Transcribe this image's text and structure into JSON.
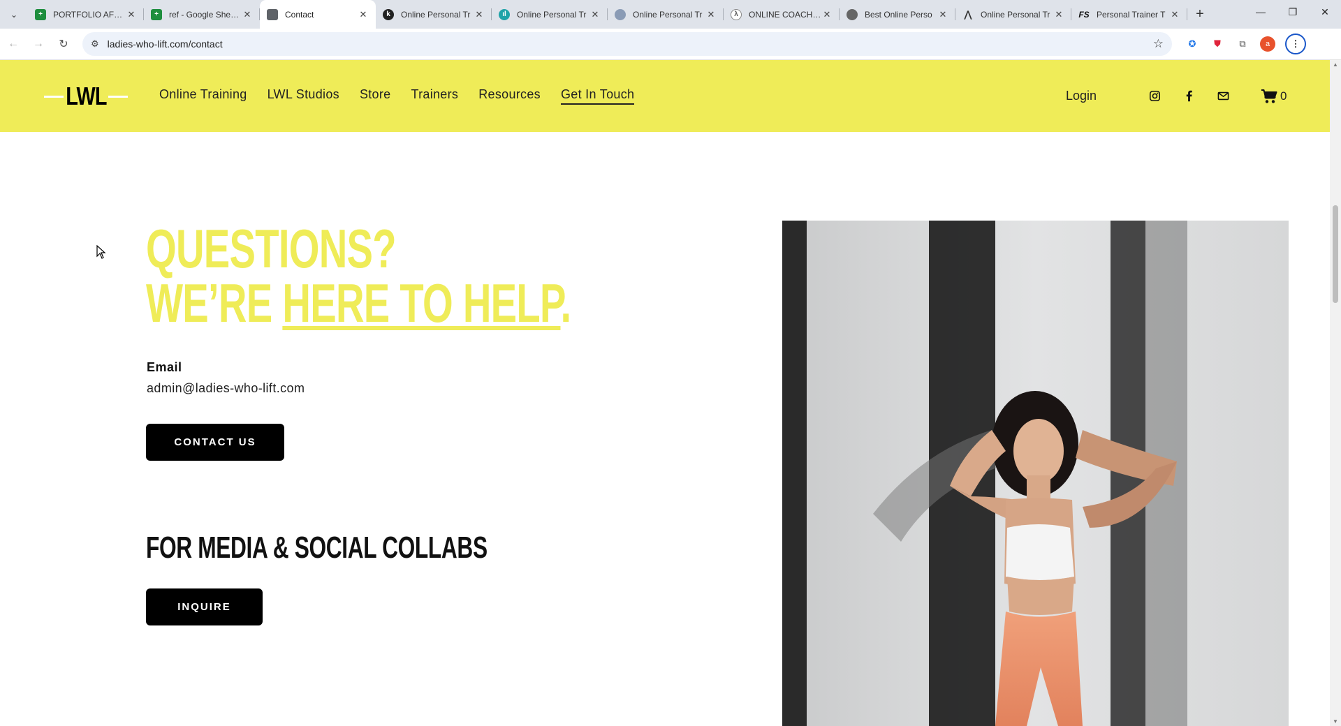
{
  "browser": {
    "tabs": [
      {
        "title": "PORTFOLIO AFTER",
        "favicon": "sheets-icon",
        "active": false
      },
      {
        "title": "ref - Google Sheets",
        "favicon": "sheets-icon",
        "active": false
      },
      {
        "title": "Contact",
        "favicon": "cube-icon",
        "active": true
      },
      {
        "title": "Online Personal Tr",
        "favicon": "k-icon",
        "active": false
      },
      {
        "title": "Online Personal Tr",
        "favicon": "bars-icon",
        "active": false
      },
      {
        "title": "Online Personal Tr",
        "favicon": "globe-icon",
        "active": false
      },
      {
        "title": "ONLINE COACHING",
        "favicon": "runner-icon",
        "active": false
      },
      {
        "title": "Best Online Perso",
        "favicon": "globe-icon",
        "active": false
      },
      {
        "title": "Online Personal Tr",
        "favicon": "tent-icon",
        "active": false
      },
      {
        "title": "Personal Trainer T",
        "favicon": "fs-icon",
        "active": false
      }
    ],
    "url": "ladies-who-lift.com/contact",
    "profile_initial": "a"
  },
  "site": {
    "logo_text": "LWL",
    "nav": [
      "Online Training",
      "LWL Studios",
      "Store",
      "Trainers",
      "Resources",
      "Get In Touch"
    ],
    "current_nav": "Get In Touch",
    "login_label": "Login",
    "cart_count": "0",
    "accent_color": "#efec58"
  },
  "contact": {
    "headline_line1": "QUESTIONS?",
    "headline_line2_prefix": "WE’RE ",
    "headline_line2_underlined": "HERE TO HELP",
    "headline_line2_suffix": ".",
    "email_label": "Email",
    "email_value": "admin@ladies-who-lift.com",
    "contact_button": "CONTACT US",
    "media_title": "FOR MEDIA & SOCIAL COLLABS",
    "inquire_button": "INQUIRE"
  }
}
